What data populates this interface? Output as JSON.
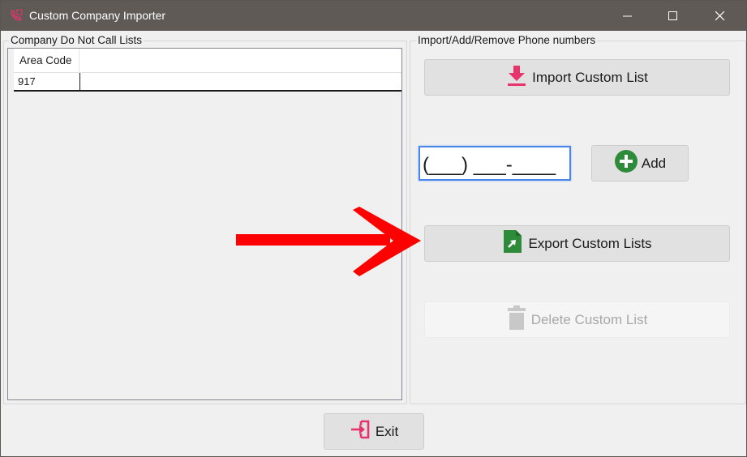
{
  "window": {
    "title": "Custom Company Importer"
  },
  "left_group": {
    "legend": "Company Do Not Call Lists",
    "grid": {
      "columns": [
        "Area Code"
      ],
      "rows": [
        [
          "917"
        ]
      ]
    }
  },
  "right_group": {
    "legend": "Import/Add/Remove Phone numbers",
    "import_label": "Import Custom List",
    "phone_value": "(___) ___-____",
    "add_label": "Add",
    "export_label": "Export Custom Lists",
    "delete_label": "Delete Custom List"
  },
  "footer": {
    "exit_label": "Exit"
  },
  "colors": {
    "titlebar": "#5f5a55",
    "import_icon": "#e8336d",
    "add_icon": "#2e8b3a",
    "export_icon": "#2e8b3a",
    "exit_icon": "#e8336d",
    "arrow": "#ff0000",
    "input_focus": "#4a86e8"
  },
  "icons": [
    "phone-app-icon",
    "download-icon",
    "plus-circle-icon",
    "export-file-icon",
    "trash-icon",
    "exit-icon"
  ]
}
